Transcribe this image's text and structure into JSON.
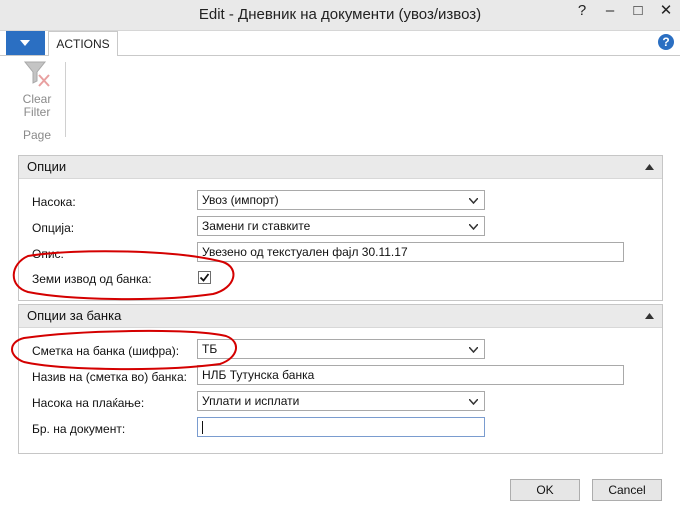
{
  "window": {
    "title": "Edit - Дневник на документи (увоз/извоз)",
    "controls": [
      "?",
      "–",
      "□",
      "✕"
    ]
  },
  "ribbon": {
    "tabs": [
      "ACTIONS"
    ],
    "clear_filter_label_1": "Clear",
    "clear_filter_label_2": "Filter",
    "group_label": "Page",
    "help": "?"
  },
  "options_section": {
    "title": "Опции",
    "direction_label": "Насока:",
    "direction_value": "Увоз (импорт)",
    "option_label": "Опција:",
    "option_value": "Замени ги ставките",
    "description_label": "Опис:",
    "description_value": "Увезено од текстуален фајл 30.11.17",
    "bank_statement_label": "Земи извод од банка:",
    "bank_statement_checked": true
  },
  "bank_section": {
    "title": "Опции за банка",
    "account_label": "Сметка на банка (шифра):",
    "account_value": "ТБ",
    "name_label": "Назив на (сметка во) банка:",
    "name_value": "НЛБ Тутунска банка",
    "payment_direction_label": "Насока на плаќање:",
    "payment_direction_value": "Уплати и исплати",
    "doc_no_label": "Бр. на документ:",
    "doc_no_value": ""
  },
  "buttons": {
    "ok": "OK",
    "cancel": "Cancel"
  },
  "colors": {
    "accent": "#2b6fc2",
    "annotation": "#d40000"
  }
}
